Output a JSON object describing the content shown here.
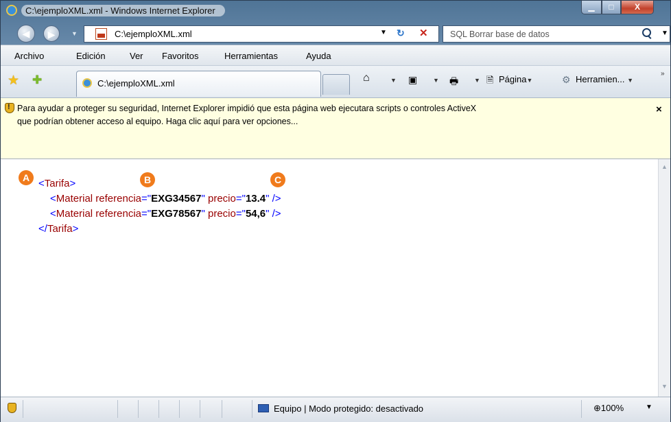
{
  "window": {
    "title": "C:\\ejemploXML.xml - Windows Internet Explorer",
    "minimize": "▁",
    "maximize": "□",
    "close": "X"
  },
  "nav": {
    "address": "C:\\ejemploXML.xml",
    "search_placeholder": "SQL Borrar base de datos"
  },
  "menu": {
    "items": [
      "Archivo",
      "Edición",
      "Ver",
      "Favoritos",
      "Herramientas",
      "Ayuda"
    ]
  },
  "command_bar": {
    "tab_title": "C:\\ejemploXML.xml",
    "page_label": "Página",
    "tools_label": "Herramien..."
  },
  "infobar": {
    "line1": "Para ayudar a proteger su seguridad, Internet Explorer impidió que esta página web ejecutara scripts o controles ActiveX",
    "line2": "que podrían obtener acceso al equipo. Haga clic aquí para ver opciones...",
    "close": "×"
  },
  "xml": {
    "root_tag": "Tarifa",
    "element_tag": "Material",
    "attr1_name": "referencia",
    "attr2_name": "precio",
    "rows": [
      {
        "referencia": "EXG34567",
        "precio": "13.4"
      },
      {
        "referencia": "EXG78567",
        "precio": "54,6"
      }
    ]
  },
  "annotations": {
    "a": "A",
    "b": "B",
    "c": "C",
    "color": "#f07b1c"
  },
  "status": {
    "zone": "Equipo | Modo protegido: desactivado",
    "zoom": "100%"
  }
}
